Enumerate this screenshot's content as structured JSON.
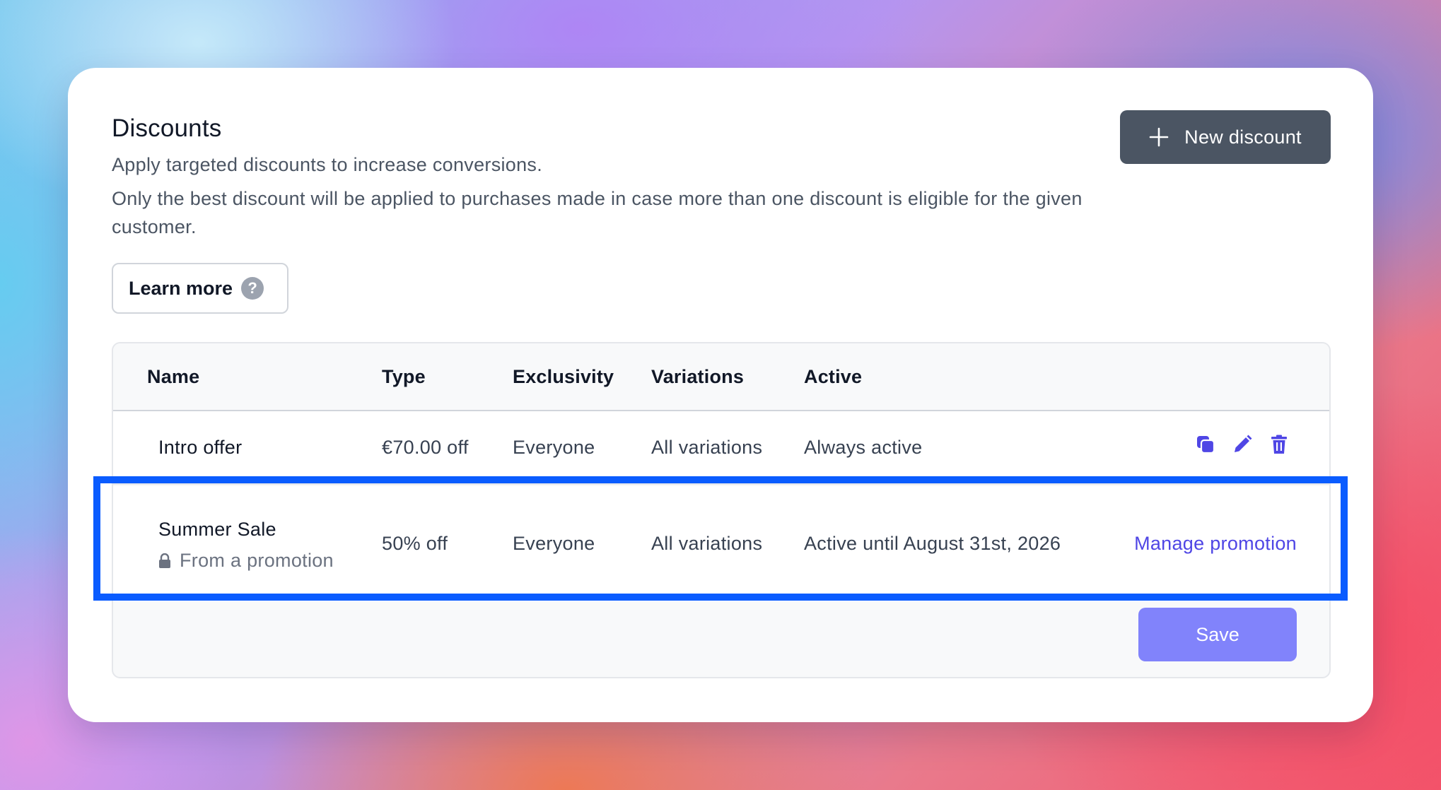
{
  "header": {
    "title": "Discounts",
    "description_line1": "Apply targeted discounts to increase conversions.",
    "description_line2": "Only the best discount will be applied to purchases made in case more than one discount is eligible for the given customer.",
    "new_button_label": "New discount",
    "learn_more_label": "Learn more",
    "help_glyph": "?"
  },
  "table": {
    "columns": [
      "Name",
      "Type",
      "Exclusivity",
      "Variations",
      "Active"
    ],
    "rows": [
      {
        "name": "Intro offer",
        "type": "€70.00 off",
        "exclusivity": "Everyone",
        "variations": "All variations",
        "active": "Always active",
        "actions": [
          "duplicate-icon",
          "edit-icon",
          "trash-icon"
        ]
      },
      {
        "name": "Summer Sale",
        "source": "From a promotion",
        "type": "50% off",
        "exclusivity": "Everyone",
        "variations": "All variations",
        "active": "Active until August 31st, 2026",
        "link_label": "Manage promotion"
      }
    ]
  },
  "footer": {
    "save_label": "Save"
  },
  "colors": {
    "accent": "#4f46e5",
    "primary_button": "#4b5563",
    "save_button": "#8183fb",
    "highlight": "#0a5cff"
  }
}
